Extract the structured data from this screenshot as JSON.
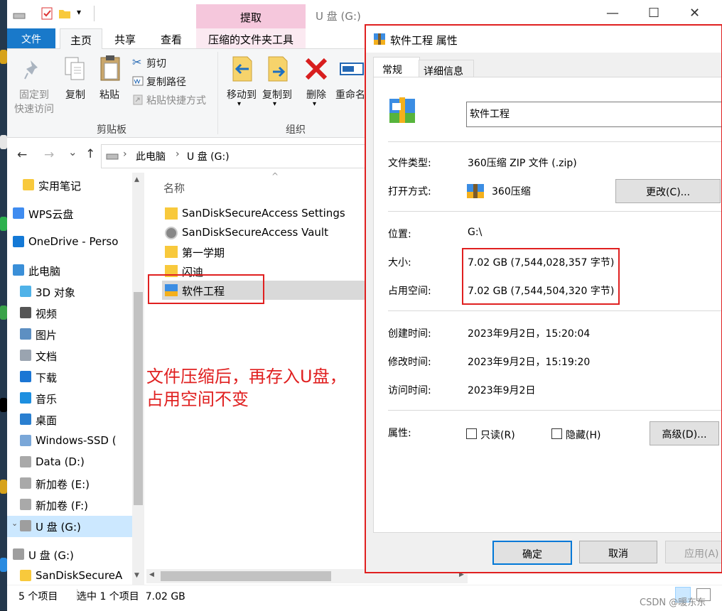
{
  "window": {
    "title": "U 盘 (G:)",
    "contextual_header": "提取",
    "minimize_glyph": "—",
    "maximize_glyph": "☐",
    "close_glyph": "✕"
  },
  "ribbon_tabs": {
    "file": "文件",
    "home": "主页",
    "share": "共享",
    "view": "查看",
    "compressed_tools": "压缩的文件夹工具"
  },
  "ribbon": {
    "pin_line1": "固定到",
    "pin_line2": "快速访问",
    "copy": "复制",
    "paste": "粘贴",
    "cut": "剪切",
    "copy_path": "复制路径",
    "paste_shortcut": "粘贴快捷方式",
    "clipboard_group": "剪贴板",
    "move_to": "移动到",
    "copy_to": "复制到",
    "delete": "删除",
    "rename": "重命名",
    "organize_group": "组织"
  },
  "nav": {
    "back_glyph": "←",
    "forward_glyph": "→",
    "recent_glyph": "⌄",
    "up_glyph": "↑",
    "crumb_sep": "›",
    "crumb1": "此电脑",
    "crumb2": "U 盘 (G:)"
  },
  "tree": [
    {
      "label": "实用笔记",
      "icon": "folder-icon"
    },
    {
      "label": "WPS云盘",
      "icon": "cloud-icon"
    },
    {
      "label": "OneDrive - Perso",
      "icon": "onedrive-icon"
    },
    {
      "label": "此电脑",
      "icon": "computer-icon"
    },
    {
      "label": "3D 对象",
      "icon": "3d-objects-icon"
    },
    {
      "label": "视频",
      "icon": "video-icon"
    },
    {
      "label": "图片",
      "icon": "pictures-icon"
    },
    {
      "label": "文档",
      "icon": "documents-icon"
    },
    {
      "label": "下载",
      "icon": "download-icon"
    },
    {
      "label": "音乐",
      "icon": "music-icon"
    },
    {
      "label": "桌面",
      "icon": "desktop-icon"
    },
    {
      "label": "Windows-SSD (",
      "icon": "windows-drive-icon"
    },
    {
      "label": "Data (D:)",
      "icon": "drive-icon"
    },
    {
      "label": "新加卷 (E:)",
      "icon": "drive-icon"
    },
    {
      "label": "新加卷 (F:)",
      "icon": "drive-icon"
    },
    {
      "label": "U 盘 (G:)",
      "icon": "usb-drive-icon"
    },
    {
      "label": "U 盘 (G:)",
      "icon": "usb-drive-icon"
    },
    {
      "label": "SanDiskSecureA",
      "icon": "folder-icon"
    }
  ],
  "filelist": {
    "header_name": "名称",
    "sort_glyph": "^",
    "files": [
      {
        "name": "SanDiskSecureAccess Settings",
        "icon": "folder-icon"
      },
      {
        "name": "SanDiskSecureAccess Vault",
        "icon": "vault-app-icon"
      },
      {
        "name": "第一学期",
        "icon": "folder-icon"
      },
      {
        "name": "闪迪",
        "icon": "folder-icon"
      },
      {
        "name": "软件工程",
        "icon": "zip-archive-icon"
      }
    ]
  },
  "annotation": {
    "line1": "文件压缩后，再存入U盘，",
    "line2": "占用空间不变"
  },
  "status": {
    "count": "5 个项目",
    "selected": "选中 1 个项目  7.02 GB"
  },
  "properties": {
    "title": "软件工程 属性",
    "tab_general": "常规",
    "tab_details": "详细信息",
    "filename": "软件工程",
    "type_label": "文件类型:",
    "type_value": "360压缩 ZIP 文件 (.zip)",
    "open_with_label": "打开方式:",
    "open_with_value": "360压缩",
    "change_button": "更改(C)...",
    "location_label": "位置:",
    "location_value": "G:\\",
    "size_label": "大小:",
    "size_value": "7.02 GB (7,544,028,357 字节)",
    "size_on_disk_label": "占用空间:",
    "size_on_disk_value": "7.02 GB (7,544,504,320 字节)",
    "created_label": "创建时间:",
    "created_value": "2023年9月2日，15:20:04",
    "modified_label": "修改时间:",
    "modified_value": "2023年9月2日，15:19:20",
    "accessed_label": "访问时间:",
    "accessed_value": "2023年9月2日",
    "attributes_label": "属性:",
    "readonly_label": "只读(R)",
    "hidden_label": "隐藏(H)",
    "advanced_button": "高级(D)...",
    "ok_button": "确定",
    "cancel_button": "取消",
    "apply_button": "应用(A)"
  },
  "watermark": "CSDN @暖东东",
  "colors": {
    "accent_blue": "#1979ca",
    "annotation_red": "#e02020",
    "context_pink": "#f5c7dc",
    "selection": "#cce8ff"
  }
}
